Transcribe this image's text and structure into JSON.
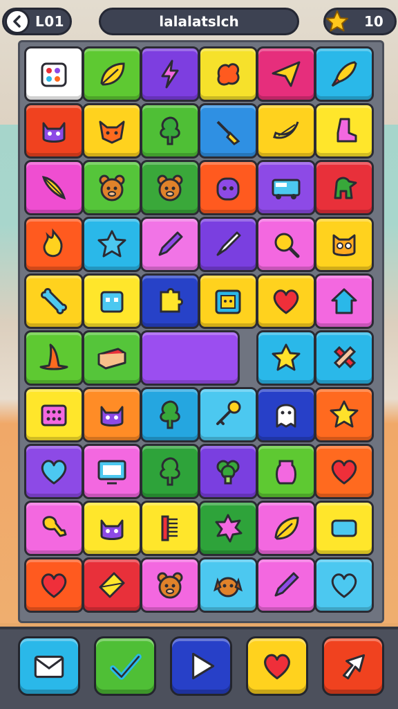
{
  "header": {
    "level_label": "L01",
    "title": "lalalatslch",
    "score": "10",
    "back_icon": "chevron-left-icon",
    "star_icon": "star-icon",
    "colors": {
      "pill": "#3d4252",
      "star": "#ffc71c"
    }
  },
  "board": {
    "rows": 10,
    "cols": 6,
    "tiles": [
      {
        "icon": "palette-icon",
        "color": "#ffffff"
      },
      {
        "icon": "leaf-icon",
        "color": "#5ec932"
      },
      {
        "icon": "lightning-icon",
        "color": "#7d3ee0"
      },
      {
        "icon": "blob-icon",
        "color": "#f6e12b"
      },
      {
        "icon": "paper-plane-icon",
        "color": "#e62e7c"
      },
      {
        "icon": "rocket-icon",
        "color": "#2ab8e9"
      },
      {
        "icon": "cat-face-icon",
        "color": "#f0421f"
      },
      {
        "icon": "fox-face-icon",
        "color": "#ffd21e"
      },
      {
        "icon": "tree-icon",
        "color": "#4fbf36"
      },
      {
        "icon": "broom-icon",
        "color": "#2f90e3"
      },
      {
        "icon": "banana-icon",
        "color": "#ffd21e"
      },
      {
        "icon": "boot-icon",
        "color": "#ffe62b"
      },
      {
        "icon": "feather-pen-icon",
        "color": "#ef4ed1"
      },
      {
        "icon": "bear-face-icon",
        "color": "#55c53a"
      },
      {
        "icon": "bear-face-icon",
        "color": "#3aa83a"
      },
      {
        "icon": "monster-face-icon",
        "color": "#ff5a1f"
      },
      {
        "icon": "truck-icon",
        "color": "#8d4ae6"
      },
      {
        "icon": "dinosaur-icon",
        "color": "#e8303a"
      },
      {
        "icon": "flame-icon",
        "color": "#ff5a1f"
      },
      {
        "icon": "star-outline-icon",
        "color": "#2ab8e9"
      },
      {
        "icon": "pencil-icon",
        "color": "#f174e6"
      },
      {
        "icon": "brush-icon",
        "color": "#7a3fe0"
      },
      {
        "icon": "magnifier-icon",
        "color": "#f368e0"
      },
      {
        "icon": "owl-face-icon",
        "color": "#ffd21e"
      },
      {
        "icon": "bone-icon",
        "color": "#ffd21e"
      },
      {
        "icon": "robot-icon",
        "color": "#ffe62b"
      },
      {
        "icon": "puzzle-icon",
        "color": "#2742c8"
      },
      {
        "icon": "gift-box-icon",
        "color": "#ffd21e"
      },
      {
        "icon": "heart-icon",
        "color": "#ffd21e"
      },
      {
        "icon": "house-icon",
        "color": "#f368e0"
      },
      {
        "icon": "witch-hat-icon",
        "color": "#5ec932"
      },
      {
        "icon": "books-icon",
        "color": "#55c53a"
      },
      {
        "icon": "empty-slot",
        "color": "#9b4ef0",
        "span": 2
      },
      {
        "icon": "star-icon",
        "color": "#2ab8e9"
      },
      {
        "icon": "cross-icon",
        "color": "#2ab8e9"
      },
      {
        "icon": "keypad-icon",
        "color": "#ffe62b"
      },
      {
        "icon": "cat-face-icon",
        "color": "#ff8c26"
      },
      {
        "icon": "tree-icon",
        "color": "#25a6e0"
      },
      {
        "icon": "key-icon",
        "color": "#4cc8f0"
      },
      {
        "icon": "ghost-icon",
        "color": "#2740c8"
      },
      {
        "icon": "star-icon",
        "color": "#ff6a1f"
      },
      {
        "icon": "heart-outline-icon",
        "color": "#8d4ae6"
      },
      {
        "icon": "monitor-icon",
        "color": "#f368e0"
      },
      {
        "icon": "tree-icon",
        "color": "#2ea33a"
      },
      {
        "icon": "broccoli-icon",
        "color": "#7a3fe0"
      },
      {
        "icon": "jar-icon",
        "color": "#5ec932"
      },
      {
        "icon": "heart-icon",
        "color": "#ff6a1f"
      },
      {
        "icon": "drumstick-icon",
        "color": "#f368e0"
      },
      {
        "icon": "cat-face-icon",
        "color": "#ffe62b"
      },
      {
        "icon": "comb-icon",
        "color": "#ffe62b"
      },
      {
        "icon": "splat-icon",
        "color": "#2ea33a"
      },
      {
        "icon": "leaf-icon",
        "color": "#f368e0"
      },
      {
        "icon": "eraser-icon",
        "color": "#ffe62b"
      },
      {
        "icon": "heart-icon",
        "color": "#ff5a1f"
      },
      {
        "icon": "kite-icon",
        "color": "#e8303a"
      },
      {
        "icon": "bear-face-icon",
        "color": "#f368e0"
      },
      {
        "icon": "dog-face-icon",
        "color": "#4cc8f0"
      },
      {
        "icon": "pencil-icon",
        "color": "#f368e0"
      },
      {
        "icon": "heart-outline-icon",
        "color": "#4cc8f0"
      }
    ]
  },
  "actions": [
    {
      "icon": "envelope-icon",
      "color": "#2ab8e9"
    },
    {
      "icon": "checkmark-icon",
      "color": "#4fbf36"
    },
    {
      "icon": "play-icon",
      "color": "#2740c8"
    },
    {
      "icon": "heart-icon",
      "color": "#ffd21e"
    },
    {
      "icon": "arrow-icon",
      "color": "#f0421f"
    }
  ]
}
